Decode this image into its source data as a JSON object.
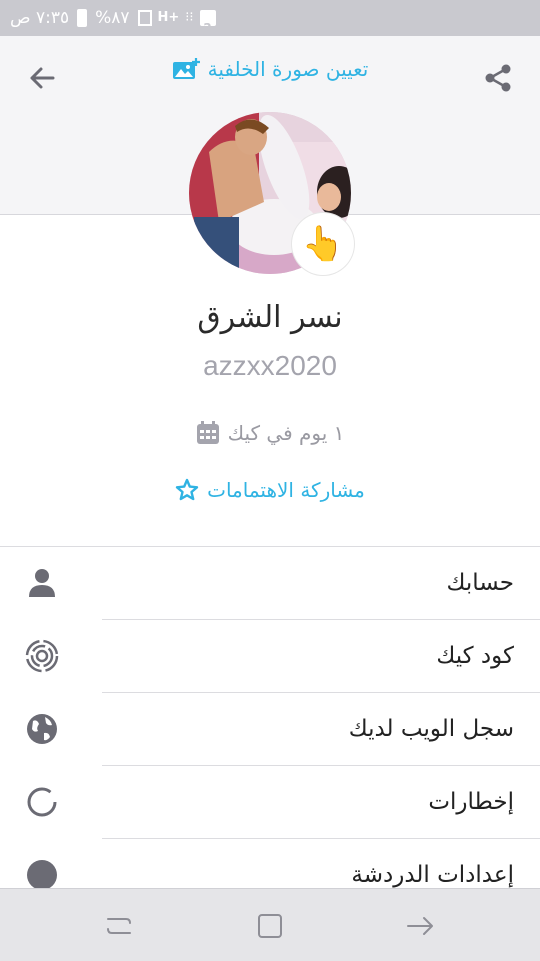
{
  "status_bar": {
    "time": "٧:٣٥ ص",
    "battery": "%٨٧",
    "notification_badge": "2"
  },
  "header": {
    "set_background_label": "تعيين صورة الخلفية",
    "back_icon": "arrow-left-icon",
    "share_icon": "share-icon",
    "image_add_icon": "image-add-icon"
  },
  "profile": {
    "name": "نسر الشرق",
    "username": "azzxx2020",
    "days_label": "١ يوم في كيك",
    "share_interests_label": "مشاركة الاهتمامات",
    "badge_emoji": "👆",
    "accent_color": "#2fb3e3"
  },
  "menu": {
    "items": [
      {
        "label": "حسابك",
        "icon": "person-icon"
      },
      {
        "label": "كود كيك",
        "icon": "kik-code-icon"
      },
      {
        "label": "سجل الويب لديك",
        "icon": "globe-icon"
      },
      {
        "label": "إخطارات",
        "icon": "notification-ring-icon"
      },
      {
        "label": "إعدادات الدردشة",
        "icon": "chat-bubble-icon"
      }
    ]
  }
}
